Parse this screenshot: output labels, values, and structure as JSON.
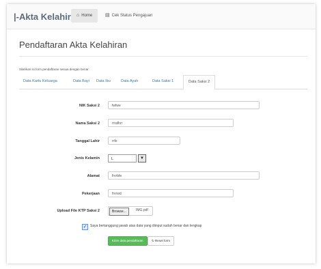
{
  "navbar": {
    "brand": "|-Akta Kelahiran",
    "home_label": "Home",
    "home_icon": "home-icon",
    "status_label": "Cek Status Pengajuan",
    "status_icon": "document-icon"
  },
  "page": {
    "title": "Pendaftaran Akta Kelahiran",
    "instruction": "Silahkan isi form pendaftaran sesuai dengan benar"
  },
  "tabs": [
    {
      "label": "Data Kartu Keluarga",
      "active": false
    },
    {
      "label": "Data Bayi",
      "active": false
    },
    {
      "label": "Data Ibu",
      "active": false
    },
    {
      "label": "Data Ayah",
      "active": false
    },
    {
      "label": "Data Saksi 1",
      "active": false
    },
    {
      "label": "Data Saksi 2",
      "active": true
    }
  ],
  "form": {
    "nik": {
      "label": "NIK Saksi 2",
      "value": "fwfwe"
    },
    "nama": {
      "label": "Nama Saksi 2",
      "value": "rrrafhrr"
    },
    "tanggal_lahir": {
      "label": "Tanggal Lahir",
      "value": "rrfe"
    },
    "jenis_kelamin": {
      "label": "Jenis Kelamin",
      "value": "L"
    },
    "alamat": {
      "label": "Alamat",
      "value": "frvrbfe"
    },
    "pekerjaan": {
      "label": "Pekerjaan",
      "value": "frvrwd"
    },
    "upload": {
      "label": "Upload File KTP Saksi 2",
      "browse_label": "Browse...",
      "file_name": "IMG.pdf"
    },
    "agreement": {
      "label": "Saya bertanggung jawab atas data yang diinput sudah benar dan lengkap",
      "checked": true
    },
    "submit_label": "Kirim data pendaftaran",
    "reset_label": "Reset form"
  },
  "colors": {
    "accent": "#337ab7",
    "submit": "#5cb85c"
  }
}
